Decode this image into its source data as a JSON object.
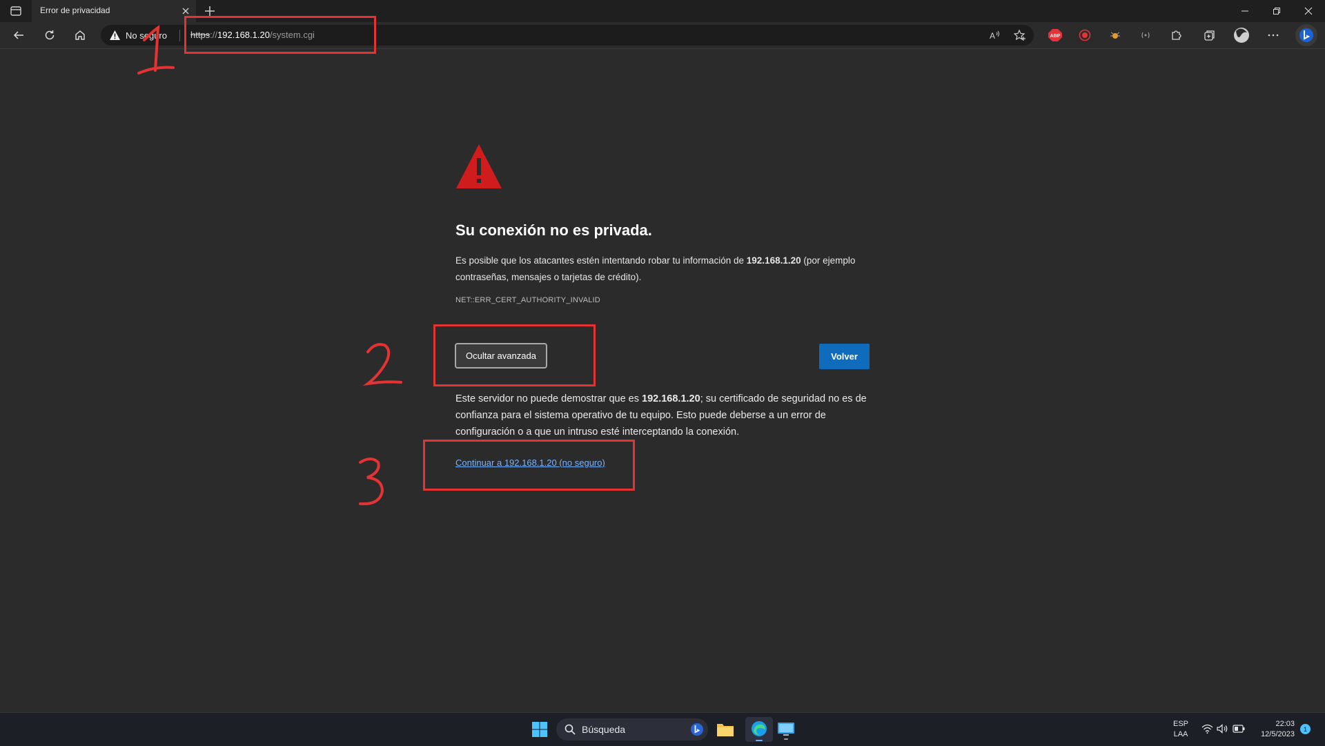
{
  "browser": {
    "tab": {
      "title": "Error de privacidad"
    },
    "security_label": "No seguro",
    "url": {
      "scheme": "https",
      "separator": "://",
      "host": "192.168.1.20",
      "path": "/system.cgi"
    },
    "extension_badge_abp": "ABP"
  },
  "page": {
    "heading": "Su conexión no es privada.",
    "description": {
      "before": "Es posible que los atacantes estén intentando robar tu información de ",
      "host": "192.168.1.20",
      "after": " (por ejemplo contraseñas, mensajes o tarjetas de crédito)."
    },
    "error_code": "NET::ERR_CERT_AUTHORITY_INVALID",
    "advanced_button": "Ocultar avanzada",
    "back_button": "Volver",
    "advanced_text": {
      "before": "Este servidor no puede demostrar que es ",
      "host": "192.168.1.20",
      "after": "; su certificado de seguridad no es de confianza para el sistema operativo de tu equipo. Esto puede deberse a un error de configuración o a que un intruso esté interceptando la conexión."
    },
    "proceed_link": "Continuar a 192.168.1.20 (no seguro)"
  },
  "annotations": {
    "step1": "1",
    "step2": "2",
    "step3": "3",
    "color": "#e43333"
  },
  "taskbar": {
    "search_placeholder": "Búsqueda",
    "language": "ESP",
    "keyboard": "LAA",
    "time": "22:03",
    "date": "12/5/2023",
    "notification_count": "1"
  },
  "colors": {
    "page_bg": "#2b2b2b",
    "primary_button": "#0f6cbd",
    "link": "#7ab5ff",
    "warning": "#d01c1c"
  }
}
